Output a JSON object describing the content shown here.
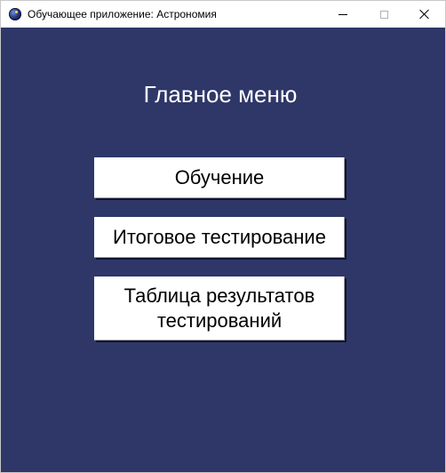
{
  "window": {
    "title": "Обучающее приложение: Астрономия",
    "background_color": "#2e3768"
  },
  "titlebar": {
    "icon": "astronomy-app-icon",
    "minimize_icon": "minimize-icon",
    "maximize_icon": "maximize-icon",
    "close_icon": "close-icon"
  },
  "main": {
    "heading": "Главное меню",
    "buttons": [
      {
        "label": "Обучение"
      },
      {
        "label": "Итоговое тестирование"
      },
      {
        "label": "Таблица результатов тестирований"
      }
    ]
  }
}
